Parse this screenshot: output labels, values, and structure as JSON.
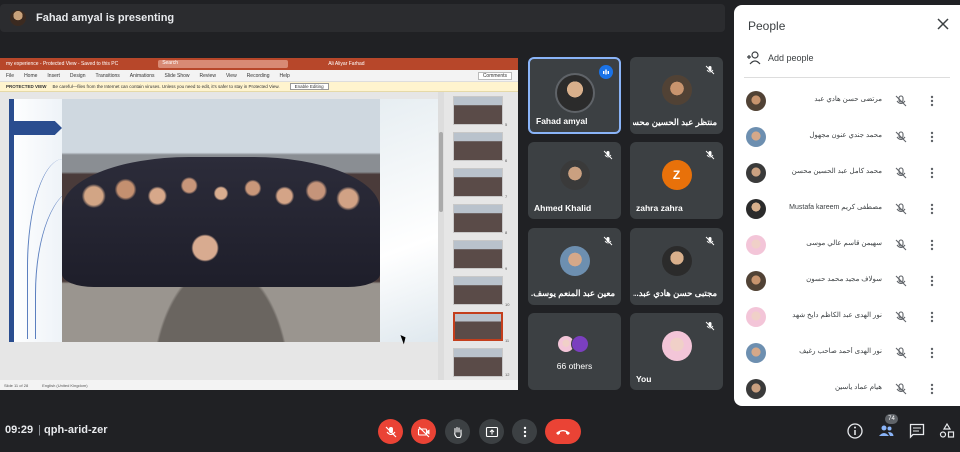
{
  "presenting": {
    "text": "Fahad amyal is presenting"
  },
  "shared_screen": {
    "app_title": "my experience - Protected View - Saved to this PC",
    "search_placeholder": "Search",
    "user": "Ali Aliyar Farhad",
    "tabs": [
      "File",
      "Home",
      "Insert",
      "Design",
      "Transitions",
      "Animations",
      "Slide Show",
      "Review",
      "View",
      "Recording",
      "Help"
    ],
    "comments_label": "Comments",
    "protected_label": "PROTECTED VIEW",
    "protected_msg": "Be careful—files from the Internet can contain viruses. Unless you need to edit, it's safer to stay in Protected View.",
    "enable_editing": "Enable Editing",
    "thumb_numbers": [
      "5",
      "6",
      "7",
      "8",
      "9",
      "10",
      "11",
      "12"
    ],
    "status_slide": "Slide 11 of 28",
    "status_lang": "English (United Kingdom)"
  },
  "tiles": [
    {
      "name": "Fahad amyal",
      "speaking": true
    },
    {
      "name": "منتظر عبد الحسين محسن..."
    },
    {
      "name": "Ahmed Khalid"
    },
    {
      "name": "zahra zahra",
      "letter": "Z"
    },
    {
      "name": "معين عبد المنعم يوسف..."
    },
    {
      "name": "مجتبى حسن هادي عبد..."
    },
    {
      "name": "66 others"
    },
    {
      "name": "You"
    }
  ],
  "people_panel": {
    "title": "People",
    "add_people": "Add people",
    "participants": [
      "مرتضى حسن هادي عبد",
      "محمد جندي عنون مجهول",
      "محمد كامل عبد الحسين محسن",
      "مصطفى كريم Mustafa kareem",
      "سهيمن قاسم عالي موسى",
      "سولاف مجيد محمد حسون",
      "نور الهدى عبد الكاظم دايخ شهد",
      "نور الهدى أحمد صاحب رغيف",
      "هيام عماد ياسين"
    ]
  },
  "bottom_bar": {
    "time": "09:29",
    "separator": "|",
    "meeting_code": "qph-arid-zer",
    "people_count": "74"
  },
  "colors": {
    "end_call": "#ea4335",
    "speaking": "#1a73e8",
    "tile_bg": "#3c4043",
    "bg": "#202124"
  }
}
